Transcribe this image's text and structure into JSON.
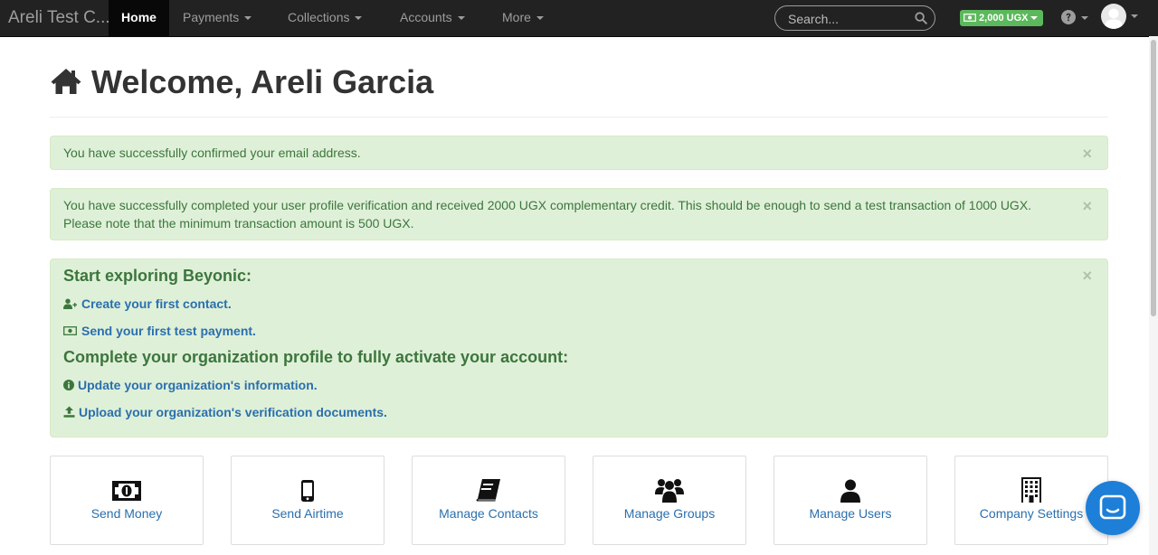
{
  "navbar": {
    "brand": "Areli Test C...",
    "items": [
      {
        "label": "Home"
      },
      {
        "label": "Payments"
      },
      {
        "label": "Collections"
      },
      {
        "label": "Accounts"
      },
      {
        "label": "More"
      }
    ],
    "active_item": "Home",
    "search_placeholder": "Search...",
    "balance": "2,000 UGX",
    "colors": {
      "bar": "#222222",
      "active": "#080808",
      "balance": "#5cb85c"
    }
  },
  "page": {
    "title": "Welcome, Areli Garcia",
    "title_icon": "home-icon"
  },
  "alerts": [
    {
      "text": "You have successfully confirmed your email address."
    },
    {
      "text": "You have successfully completed your user profile verification and received 2000 UGX complementary credit. This should be enough to send a test transaction of 1000 UGX. Please note that the minimum transaction amount is 500 UGX."
    }
  ],
  "onboarding": {
    "heading1": "Start exploring Beyonic:",
    "link1": "Create your first contact.",
    "link2": "Send your first test payment.",
    "heading2": "Complete your organization profile to fully activate your account:",
    "link3": "Update your organization's information.",
    "link4": "Upload your organization's verification documents.",
    "colors": {
      "background": "#dff0d8",
      "text": "#3c763d",
      "link": "#2a6fae"
    }
  },
  "close_glyph": "×",
  "tiles": [
    {
      "label": "Send Money",
      "icon": "money-icon"
    },
    {
      "label": "Send Airtime",
      "icon": "mobile-phone-icon"
    },
    {
      "label": "Manage Contacts",
      "icon": "address-book-icon"
    },
    {
      "label": "Manage Groups",
      "icon": "users-icon"
    },
    {
      "label": "Manage Users",
      "icon": "user-icon"
    },
    {
      "label": "Company Settings",
      "icon": "building-icon"
    }
  ],
  "chat": {
    "icon": "chat-bubble-icon",
    "color": "#1d7fd8"
  }
}
